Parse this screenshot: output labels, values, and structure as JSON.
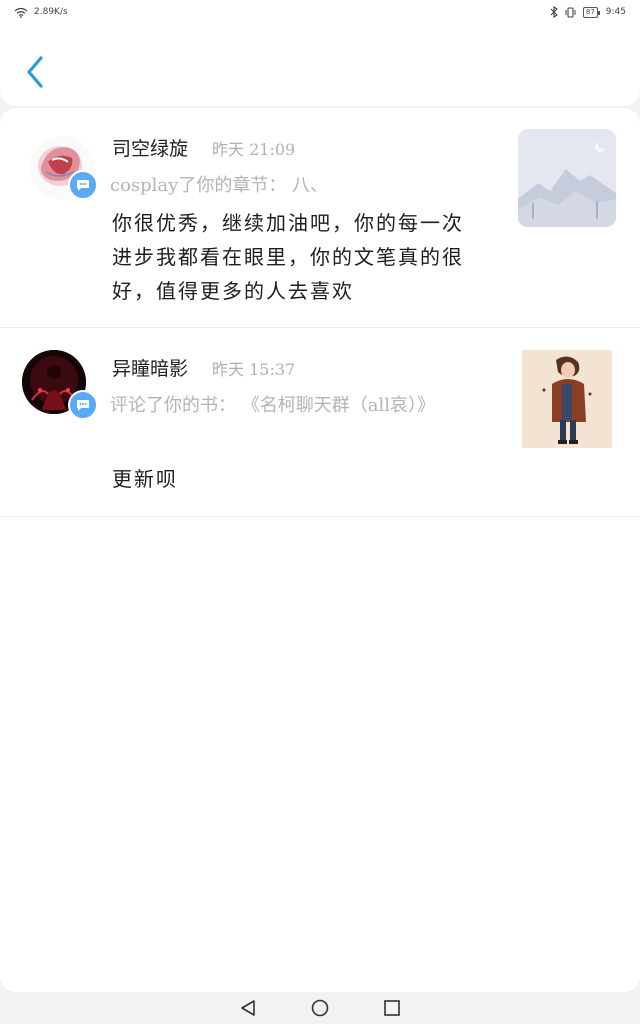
{
  "status_bar": {
    "net_speed": "2.89K/s",
    "battery": "87",
    "time": "9:45"
  },
  "notifications": [
    {
      "user": "司空绿旋",
      "time": "昨天 21:09",
      "action": "cosplay了你的章节：  八、",
      "comment": "你很优秀，继续加油吧，你的每一次进步我都看在眼里，你的文笔真的很好，值得更多的人去喜欢"
    },
    {
      "user": "异瞳暗影",
      "time": "昨天 15:37",
      "action": "评论了你的书：  《名柯聊天群（all哀）》",
      "comment": "更新呗"
    }
  ],
  "colors": {
    "accent": "#2b9bde",
    "badge": "#5aa9f4"
  }
}
